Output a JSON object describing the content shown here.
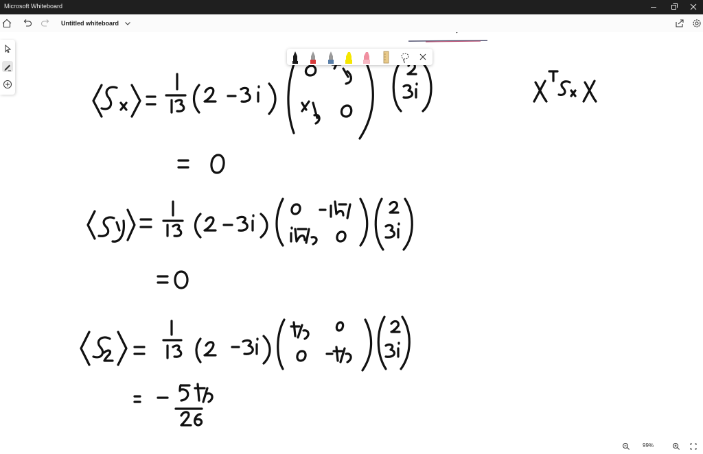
{
  "window": {
    "app_title": "Microsoft Whiteboard",
    "minimize_icon": "minimize-icon",
    "restore_icon": "restore-icon",
    "close_icon": "close-icon"
  },
  "toolbar": {
    "board_title": "Untitled whiteboard",
    "left_icons": [
      "home-icon",
      "undo-icon",
      "redo-icon"
    ],
    "right_icons": [
      "share-icon",
      "settings-icon"
    ]
  },
  "side_tools": [
    "select-icon",
    "ink-icon",
    "add-icon"
  ],
  "pen_tray": {
    "pens": [
      {
        "name": "black-pen",
        "color": "#1a1a1a"
      },
      {
        "name": "red-pen",
        "color": "#d83b3b"
      },
      {
        "name": "blue-pen",
        "color": "#5a7fa8"
      },
      {
        "name": "yellow-highlighter",
        "color": "#f5e600"
      },
      {
        "name": "pink-highlighter",
        "color": "#f08fa0"
      }
    ],
    "tools": [
      "ruler-icon",
      "lasso-icon",
      "close-icon"
    ]
  },
  "canvas": {
    "ink_color": "#111111",
    "equations": [
      {
        "name": "Sx-expectation",
        "lhs": "⟨Sx⟩ =",
        "coeff_num": "1",
        "coeff_den": "13",
        "row": "(2  -3i)",
        "matrix": [
          [
            "0",
            "ħ/2"
          ],
          [
            "ħ/2",
            "0"
          ]
        ],
        "vector": [
          "2",
          "3i"
        ]
      },
      {
        "name": "Sx-result",
        "text": "= 0"
      },
      {
        "name": "Sy-expectation",
        "lhs": "⟨Sy⟩ =",
        "coeff_num": "1",
        "coeff_den": "13",
        "row": "(2 - 3i)",
        "matrix": [
          [
            "0",
            "-iħ/2"
          ],
          [
            "iħ/2",
            "0"
          ]
        ],
        "vector": [
          "2",
          "3i"
        ]
      },
      {
        "name": "Sy-result",
        "text": "= 0"
      },
      {
        "name": "Sz-expectation",
        "lhs": "⟨Sz⟩ =",
        "coeff_num": "1",
        "coeff_den": "13",
        "row": "(2  -3i)",
        "matrix": [
          [
            "ħ/2",
            "0"
          ],
          [
            "0",
            "-ħ/2"
          ]
        ],
        "vector": [
          "2",
          "3i"
        ]
      },
      {
        "name": "Sz-result",
        "prefix": "= -",
        "num": "5ħ",
        "den": "26"
      },
      {
        "name": "side-note",
        "text": "χ† Sx χ"
      }
    ]
  },
  "status": {
    "zoom": "99%",
    "zoom_out_icon": "zoom-out-icon",
    "zoom_in_icon": "zoom-in-icon",
    "fit_icon": "fit-screen-icon"
  }
}
